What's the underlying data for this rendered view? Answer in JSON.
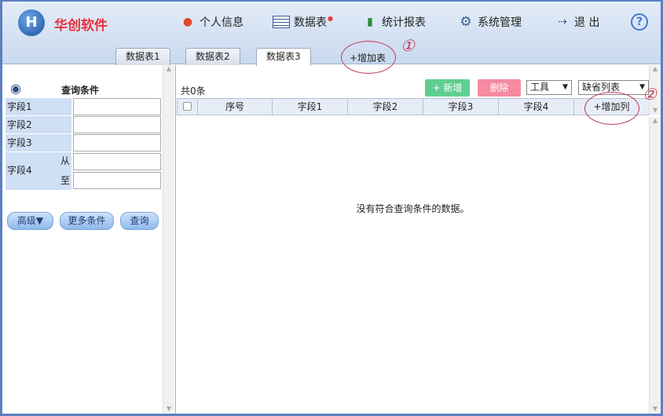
{
  "header": {
    "logo_text": "H",
    "brand": "华创软件",
    "nav": [
      {
        "label": "个人信息",
        "icon": "user-icon"
      },
      {
        "label": "数据表",
        "icon": "table-icon"
      },
      {
        "label": "统计报表",
        "icon": "chart-icon"
      },
      {
        "label": "系统管理",
        "icon": "gear-icon"
      },
      {
        "label": "退 出",
        "icon": "logout-icon"
      }
    ],
    "help": "?"
  },
  "tabs": [
    "数据表1",
    "数据表2",
    "数据表3"
  ],
  "active_tab": "数据表3",
  "add_table": "+增加表",
  "annotations": [
    "①",
    "②"
  ],
  "query": {
    "title": "查询条件",
    "fields": [
      "字段1",
      "字段2",
      "字段3",
      "字段4"
    ],
    "from": "从",
    "to": "至",
    "buttons": {
      "advanced": "高级▼",
      "more": "更多条件",
      "search": "查询"
    }
  },
  "grid": {
    "count": "共0条",
    "add": "+ 新增",
    "delete": "删除",
    "tools": "工具",
    "view": "缺省列表",
    "columns": [
      "序号",
      "字段1",
      "字段2",
      "字段3",
      "字段4"
    ],
    "add_column": "+增加列",
    "empty": "没有符合查询条件的数据。"
  }
}
